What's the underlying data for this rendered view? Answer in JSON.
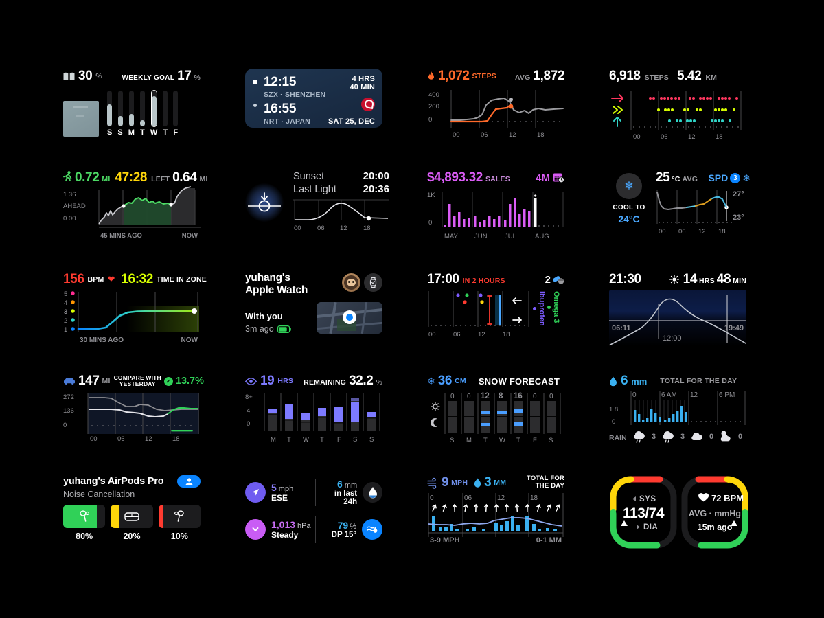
{
  "theme": {
    "bg": "#000000",
    "muted": "#8e8e93"
  },
  "widgets": {
    "reading": {
      "name": "reading-goal",
      "icon": "book-icon",
      "value": "30",
      "unit": "%",
      "goal_label": "WEEKLY GOAL",
      "goal_value": "17",
      "goal_unit": "%",
      "days": [
        "S",
        "S",
        "M",
        "T",
        "W",
        "T",
        "F"
      ],
      "values": [
        62,
        28,
        34,
        18,
        85,
        0,
        0
      ],
      "selected_index": 4
    },
    "flight": {
      "name": "flight-status",
      "depart_time": "12:15",
      "depart_place": "SZX · SHENZHEN",
      "arrive_time": "16:55",
      "arrive_place": "NRT · JAPAN",
      "duration_line1": "4 HRS",
      "duration_line2": "40 MIN",
      "date": "SAT 25, DEC",
      "airline_icon": "jal-logo-icon"
    },
    "steps_chart": {
      "name": "steps-activity",
      "icon": "flame-icon",
      "value": "1,072",
      "unit": "STEPS",
      "avg_label": "AVG",
      "avg_value": "1,872",
      "accent": "#ff6a2a",
      "chart_data": {
        "type": "line",
        "title": "Steps today vs average",
        "xlabel": "",
        "ylabel": "",
        "ylim": [
          0,
          450
        ],
        "yticks": [
          0,
          200,
          400
        ],
        "xticks": [
          "00",
          "06",
          "12",
          "18"
        ],
        "series": [
          {
            "name": "Average",
            "color": "#9a9a9e",
            "values": [
              15,
              14,
              16,
              15,
              20,
              28,
              40,
              120,
              300,
              330,
              345,
              352,
              360,
              300,
              170,
              150,
              185,
              160,
              175,
              130,
              150,
              168,
              175,
              180
            ]
          },
          {
            "name": "Today",
            "color": "#ff6a2a",
            "values": [
              8,
              8,
              8,
              8,
              8,
              8,
              10,
              20,
              170,
              200,
              205,
              210,
              270,
              null,
              null,
              null,
              null,
              null,
              null,
              null,
              null,
              null,
              null,
              null
            ]
          }
        ]
      }
    },
    "walking": {
      "name": "walking-steps-distance",
      "steps": "6,918",
      "steps_unit": "STEPS",
      "distance": "5.42",
      "distance_unit": "KM",
      "rows": [
        {
          "icon": "arrow-right-icon",
          "color": "#ff375f"
        },
        {
          "icon": "chevrons-right-icon",
          "color": "#d8ff00"
        },
        {
          "icon": "arrow-up-icon",
          "color": "#30d5c8"
        }
      ],
      "xticks": [
        "00",
        "06",
        "12",
        "18"
      ]
    },
    "workout": {
      "name": "workout-pace",
      "icon": "runner-icon",
      "distance": "0.72",
      "distance_unit": "MI",
      "time": "47:28",
      "left_label": "LEFT",
      "left_value": "0.64",
      "left_unit": "MI",
      "ymax": "1.36",
      "ystate": "AHEAD",
      "ymin": "0.00",
      "x_left": "45 MINS AGO",
      "x_right": "NOW",
      "accent": "#4cd964",
      "time_color": "#ffd60a"
    },
    "sunset": {
      "name": "sunset-card",
      "icon": "sunset-icon",
      "rows": [
        {
          "label": "Sunset",
          "value": "20:00"
        },
        {
          "label": "Last Light",
          "value": "20:36"
        }
      ],
      "xticks": [
        "00",
        "06",
        "12",
        "18"
      ]
    },
    "sales": {
      "name": "sales-chart",
      "value": "$4,893.32",
      "unit": "SALES",
      "range": "4M",
      "range_icon": "calendar-clock-icon",
      "accent": "#da5cf5",
      "chart_data": {
        "type": "bar",
        "title": "Sales",
        "ylim": [
          0,
          1000
        ],
        "yticks": [
          "1K",
          "0"
        ],
        "categories": [
          "MAY",
          "JUN",
          "JUL",
          "AUG"
        ],
        "values": [
          80,
          330,
          150,
          210,
          110,
          120,
          160,
          60,
          90,
          150,
          110,
          150,
          100,
          330,
          420,
          180,
          260,
          230,
          420,
          0,
          0,
          0,
          0,
          0,
          0,
          0,
          0,
          0
        ],
        "highlight_index": 19
      }
    },
    "climate": {
      "name": "climate-control",
      "icon": "snowflake-icon",
      "temp": "25",
      "temp_unit": "°C",
      "avg_label": "AVG",
      "spd_label": "SPD",
      "spd_value": "3",
      "fan_icon": "fan-icon",
      "cool_label": "COOL TO",
      "cool_value": "24°C",
      "hi": "27°",
      "lo": "23°",
      "xticks": [
        "00",
        "06",
        "12",
        "18"
      ]
    },
    "heartrate": {
      "name": "heart-rate-zones",
      "bpm": "156",
      "bpm_unit": "BPM",
      "heart_icon": "heart-icon",
      "time": "16:32",
      "time_label": "TIME IN ZONE",
      "zones": [
        "5",
        "4",
        "3",
        "2",
        "1"
      ],
      "zone_colors": [
        "#ff2d92",
        "#ff9500",
        "#d8ff00",
        "#30d5c8",
        "#0a84ff"
      ],
      "active_zone": "3",
      "x_left": "30 MINS AGO",
      "x_right": "NOW",
      "bpm_color": "#ff3b30",
      "time_color": "#d8ff00"
    },
    "findmy": {
      "name": "find-my-device",
      "title_line1": "yuhang's",
      "title_line2": "Apple Watch",
      "status": "With you",
      "updated": "3m ago",
      "avatar_icon": "memoji-avatar-icon",
      "device_icon": "apple-watch-icon",
      "battery_icon": "battery-icon",
      "map_icon": "map-thumbnail-icon"
    },
    "medications": {
      "name": "medications-schedule",
      "time": "17:00",
      "time_note": "IN 2 HOURS",
      "count": "2",
      "pill_icon": "pills-icon",
      "legend": [
        {
          "label": "Omega 3",
          "color": "#30d158"
        },
        {
          "label": "Ibuprofen",
          "color": "#7d5cff"
        }
      ],
      "xticks": [
        "00",
        "06",
        "12",
        "18"
      ]
    },
    "daylight": {
      "name": "daylight-duration",
      "time": "21:30",
      "icon": "sun-icon",
      "duration_hrs": "14",
      "duration_hrs_unit": "HRS",
      "duration_min": "48",
      "duration_min_unit": "MIN",
      "sunrise": "06:11",
      "noon": "12:00",
      "sunset": "19:49"
    },
    "car": {
      "name": "car-range",
      "icon": "car-icon",
      "value": "147",
      "unit": "MI",
      "compare_line1": "COMPARE WITH",
      "compare_line2": "YESTERDAY",
      "delta": "13.7%",
      "delta_icon": "check-circle-icon",
      "yticks": [
        "272",
        "136",
        "0"
      ],
      "xticks": [
        "00",
        "06",
        "12",
        "18"
      ],
      "accent": "#30d158"
    },
    "screentime": {
      "name": "screen-time",
      "icon": "eye-icon",
      "value": "19",
      "unit": "HRS",
      "remaining_label": "REMAINING",
      "remaining_value": "32.2",
      "remaining_unit": "%",
      "yticks": [
        "8+",
        "4",
        "0"
      ],
      "days": [
        "M",
        "T",
        "W",
        "T",
        "F",
        "S",
        "S"
      ],
      "accent": "#7d7aff",
      "chart_data": {
        "type": "bar",
        "categories": [
          "M",
          "T",
          "W",
          "T",
          "F",
          "S",
          "S"
        ],
        "values": [
          4.2,
          5.2,
          3.2,
          4.4,
          4.6,
          6.6,
          3.3
        ],
        "ylim": [
          0,
          8
        ]
      }
    },
    "snow": {
      "name": "snow-forecast",
      "icon": "snowflake-icon",
      "value": "36",
      "unit": "CM",
      "title": "SNOW FORECAST",
      "day_icon": "sun-icon",
      "night_icon": "moon-icon",
      "days": [
        "S",
        "M",
        "T",
        "W",
        "T",
        "F",
        "S"
      ],
      "amounts": [
        "0",
        "0",
        "12",
        "8",
        "16",
        "0",
        "0"
      ],
      "accent": "#4a9eff"
    },
    "rain": {
      "name": "rainfall-forecast",
      "icon": "raindrop-icon",
      "value": "6",
      "unit": "mm",
      "title": "TOTAL FOR THE DAY",
      "xticks": [
        "0",
        "6 AM",
        "12",
        "6 PM"
      ],
      "yticks": [
        "1.8",
        "0"
      ],
      "rain_label": "RAIN",
      "blocks": [
        {
          "icon": "cloud-rain-icon",
          "value": "3"
        },
        {
          "icon": "cloud-rain-icon",
          "value": "3"
        },
        {
          "icon": "cloud-icon",
          "value": "0"
        },
        {
          "icon": "cloud-sun-icon",
          "value": "0"
        }
      ],
      "accent": "#3ab0f0"
    },
    "airpods": {
      "name": "airpods-battery",
      "title": "yuhang's AirPods Pro",
      "subtitle": "Noise Cancellation",
      "share_icon": "share-audio-icon",
      "items": [
        {
          "icon": "airpods-left-icon",
          "pct": "80%",
          "color": "#30d158"
        },
        {
          "icon": "airpods-case-icon",
          "pct": "20%",
          "color": "#ffd60a"
        },
        {
          "icon": "airpods-right-icon",
          "pct": "10%",
          "color": "#ff3b30"
        }
      ]
    },
    "weatherquad": {
      "name": "weather-details",
      "cells": [
        {
          "icon": "wind-direction-icon",
          "icon_color": "#7d5cff",
          "value": "5",
          "unit": "mph",
          "sub": "ESE"
        },
        {
          "icon": "raindrop-icon",
          "icon_color": "#0a84ff",
          "value": "6",
          "unit": "mm",
          "sub": "in last 24h",
          "align": "right"
        },
        {
          "icon": "chevron-down-icon",
          "icon_color": "#c95cf5",
          "value": "1,013",
          "unit": "hPa",
          "sub": "Steady"
        },
        {
          "icon": "humidity-icon",
          "icon_color": "#0a84ff",
          "value": "79",
          "unit": "%",
          "sub": "DP 15°",
          "align": "right"
        }
      ]
    },
    "windrain": {
      "name": "wind-and-rain",
      "wind_icon": "wind-icon",
      "wind_value": "9",
      "wind_unit": "MPH",
      "rain_icon": "raindrop-icon",
      "rain_value": "3",
      "rain_unit": "MM",
      "title_line1": "TOTAL FOR",
      "title_line2": "THE DAY",
      "xticks": [
        "0",
        "06",
        "12",
        "18"
      ],
      "footer_left": "3-9 MPH",
      "footer_right": "0-1 MM",
      "accent": "#3ab0f0"
    },
    "bloodpressure": {
      "name": "blood-pressure",
      "sys_label": "SYS",
      "dia_label": "DIA",
      "reading": "113/74",
      "heart_icon": "heart-icon",
      "bpm": "72 BPM",
      "avg_label": "AVG · mmHg",
      "updated": "15m ago",
      "colors": {
        "high": "#ff3b30",
        "mid": "#ffd60a",
        "good": "#30d158"
      }
    }
  }
}
